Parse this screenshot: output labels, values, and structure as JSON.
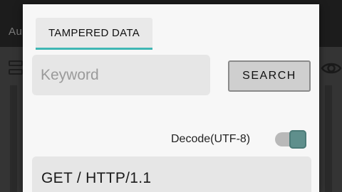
{
  "background": {
    "title": "Au"
  },
  "dialog": {
    "tab": {
      "label": "TAMPERED DATA",
      "accent_color": "#3fb6b4"
    },
    "search": {
      "placeholder": "Keyword",
      "value": "",
      "button_label": "SEARCH"
    },
    "decode": {
      "label": "Decode(UTF-8)",
      "enabled": true
    },
    "request": {
      "first_line": "GET / HTTP/1.1"
    }
  },
  "icons": {
    "list": "list-icon",
    "eye": "eye-icon"
  }
}
